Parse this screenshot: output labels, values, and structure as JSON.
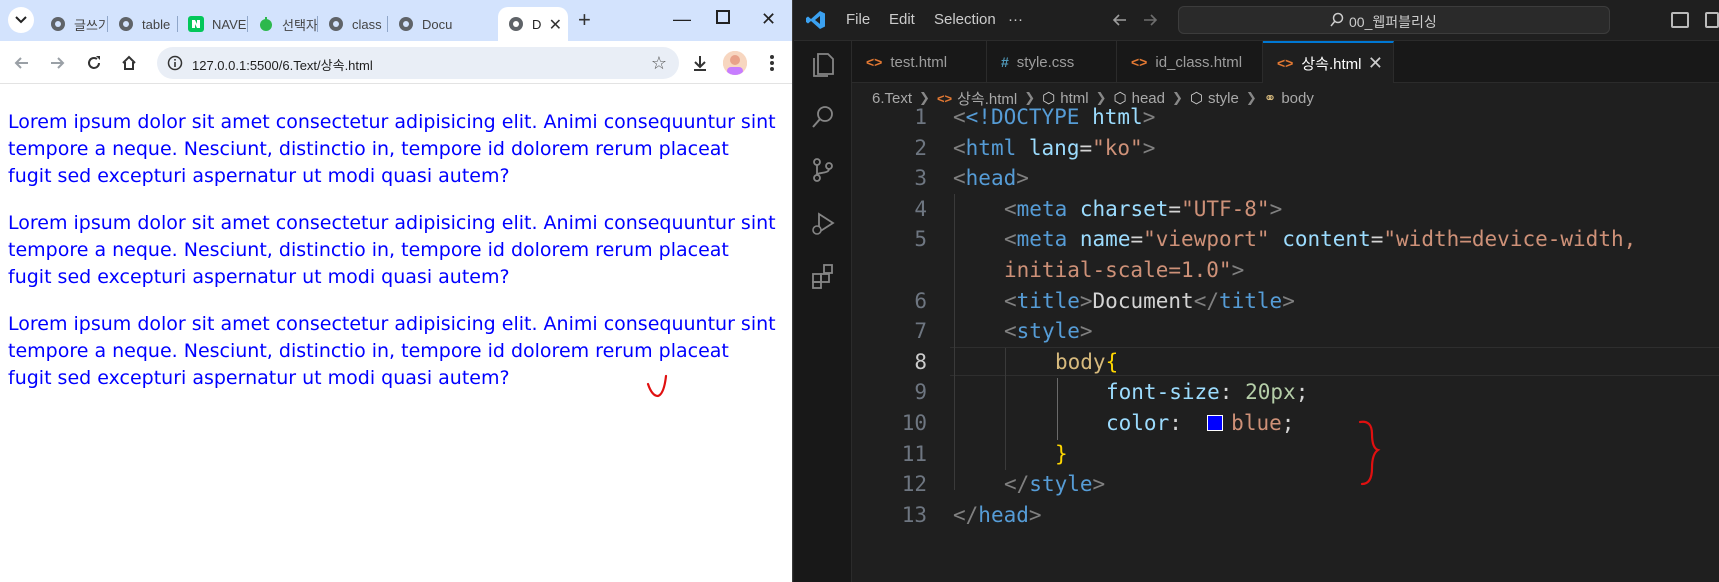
{
  "browser": {
    "tabs": [
      {
        "label": "글쓰기"
      },
      {
        "label": "table"
      },
      {
        "label": "NAVER"
      },
      {
        "label": "선택자"
      },
      {
        "label": "class"
      },
      {
        "label": "Docu"
      },
      {
        "label": "D"
      }
    ],
    "url": "127.0.0.1:5500/6.Text/상속.html",
    "paragraphs": [
      "Lorem ipsum dolor sit amet consectetur adipisicing elit. Animi consequuntur sint tempore a neque. Nesciunt, distinctio in, tempore id dolorem rerum placeat fugit sed excepturi aspernatur ut modi quasi autem?",
      "Lorem ipsum dolor sit amet consectetur adipisicing elit. Animi consequuntur sint tempore a neque. Nesciunt, distinctio in, tempore id dolorem rerum placeat fugit sed excepturi aspernatur ut modi quasi autem?",
      "Lorem ipsum dolor sit amet consectetur adipisicing elit. Animi consequuntur sint tempore a neque. Nesciunt, distinctio in, tempore id dolorem rerum placeat fugit sed excepturi aspernatur ut modi quasi autem?"
    ],
    "text_color": "#0000ff",
    "tabstrip_color": "#d3e3fd"
  },
  "vscode": {
    "menu": [
      "File",
      "Edit",
      "Selection",
      "···"
    ],
    "search_text": "00_웹퍼블리싱",
    "tabs": [
      {
        "icon": "<>",
        "label": "test.html"
      },
      {
        "icon": "#",
        "label": "style.css"
      },
      {
        "icon": "<>",
        "label": "id_class.html"
      },
      {
        "icon": "<>",
        "label": "상속.html"
      }
    ],
    "breadcrumbs": [
      "6.Text",
      "상속.html",
      "html",
      "head",
      "style",
      "body"
    ],
    "line_numbers": [
      "1",
      "2",
      "3",
      "4",
      "5",
      "",
      "6",
      "7",
      "8",
      "9",
      "10",
      "11",
      "12",
      "13"
    ],
    "code": {
      "l1_doctype": "<!DOCTYPE",
      "l1_html": "html",
      "l1_close": ">",
      "lt": "<",
      "gt": ">",
      "lt_slash": "</",
      "eq": "=",
      "html": "html",
      "lang": "lang",
      "lang_val": "\"ko\"",
      "head": "head",
      "meta": "meta",
      "charset": "charset",
      "charset_val": "\"UTF-8\"",
      "name": "name",
      "name_val": "\"viewport\"",
      "content": "content",
      "content_val1": "\"width=device-width,",
      "content_val2": "initial-scale=1.0\"",
      "title": "title",
      "title_text": "Document",
      "style": "style",
      "selector": "body",
      "brace_open": "{",
      "brace_close": "}",
      "prop1": "font-size",
      "colon": ":",
      "val1": "20px",
      "semi": ";",
      "prop2": "color",
      "val2": "blue"
    },
    "accent_color": "#0078d4",
    "swatch_color": "#0000ff"
  }
}
